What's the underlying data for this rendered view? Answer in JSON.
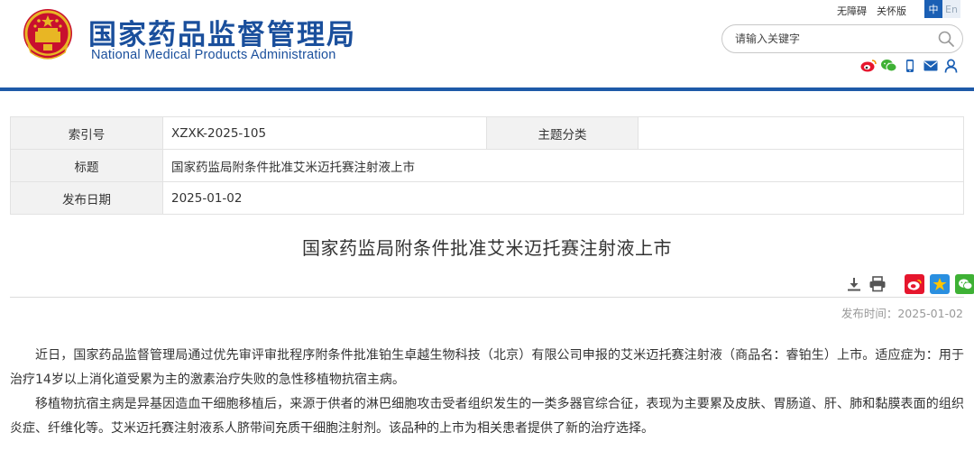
{
  "header": {
    "site_name_cn": "国家药品监督管理局",
    "site_name_en": "National Medical Products Administration",
    "links": [
      "无障碍",
      "关怀版"
    ],
    "lang_cn": "中",
    "lang_en": "En",
    "search_placeholder": "请输入关键字",
    "share_icons": [
      "weibo-icon",
      "wechat-icon",
      "mobile-icon",
      "mail-icon",
      "user-icon"
    ],
    "brand_color": "#1a4f9c"
  },
  "info": {
    "index_label": "索引号",
    "index_value": "XZXK-2025-105",
    "category_label": "主题分类",
    "category_value": "",
    "title_label": "标题",
    "title_value": "国家药监局附条件批准艾米迈托赛注射液上市",
    "date_label": "发布日期",
    "date_value": "2025-01-02"
  },
  "article": {
    "title": "国家药监局附条件批准艾米迈托赛注射液上市",
    "tools": [
      "download-icon",
      "print-icon",
      "weibo-share-icon",
      "qzone-share-icon",
      "wechat-share-icon"
    ],
    "pub_date": "发布时间：2025-01-02",
    "paragraphs": [
      "近日，国家药品监督管理局通过优先审评审批程序附条件批准铂生卓越生物科技（北京）有限公司申报的艾米迈托赛注射液（商品名：睿铂生）上市。适应症为：用于治疗14岁以上消化道受累为主的激素治疗失败的急性移植物抗宿主病。",
      "移植物抗宿主病是异基因造血干细胞移植后，来源于供者的淋巴细胞攻击受者组织发生的一类多器官综合征，表现为主要累及皮肤、胃肠道、肝、肺和黏膜表面的组织炎症、纤维化等。艾米迈托赛注射液系人脐带间充质干细胞注射剂。该品种的上市为相关患者提供了新的治疗选择。"
    ]
  }
}
